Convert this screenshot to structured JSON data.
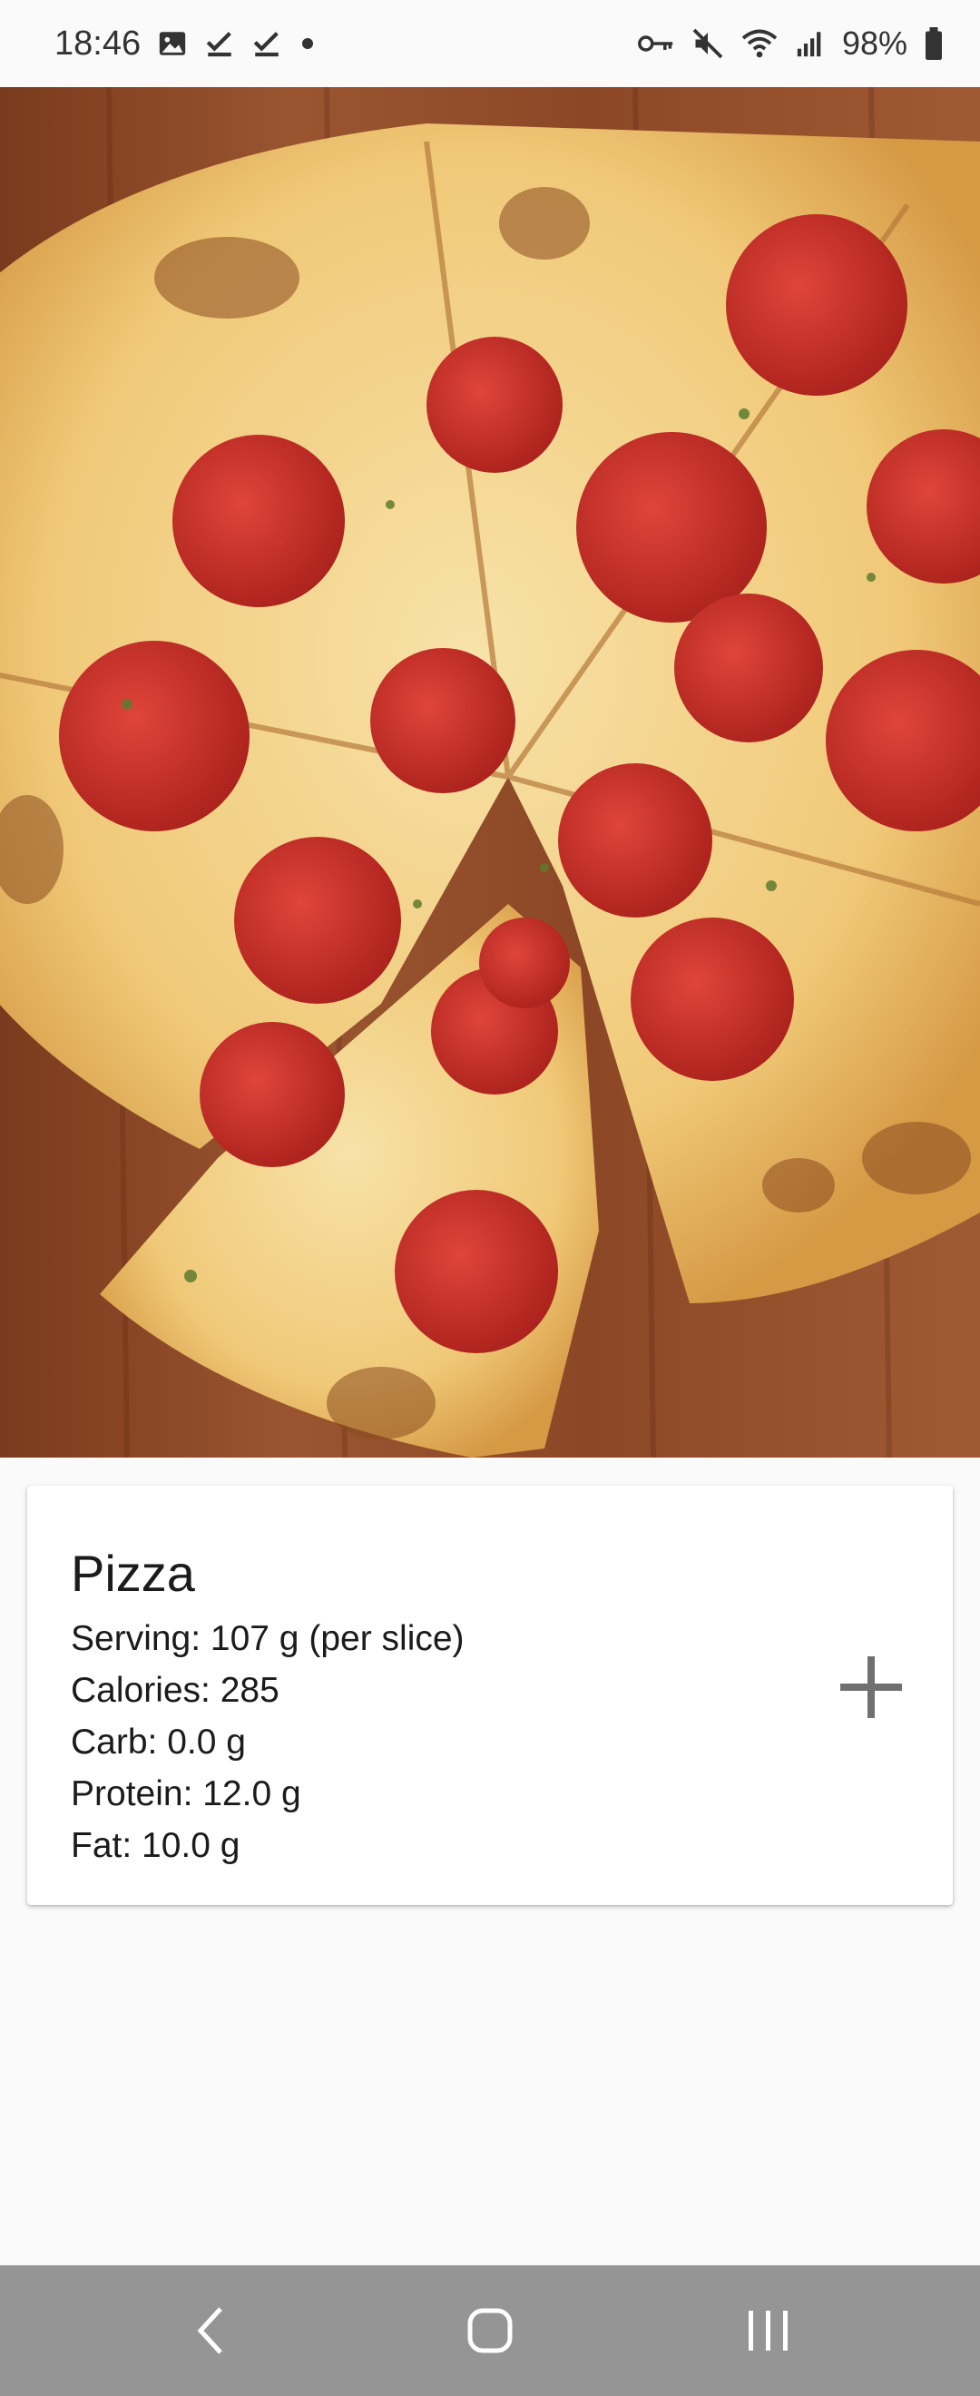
{
  "status_bar": {
    "time": "18:46",
    "battery": "98%",
    "left_icons": [
      "gallery-icon",
      "check-icon",
      "check-icon",
      "dot-icon"
    ],
    "right_icons": [
      "key-icon",
      "mute-icon",
      "wifi-icon",
      "signal-icon",
      "battery-icon"
    ]
  },
  "hero_image": {
    "subject": "pepperoni pizza"
  },
  "food": {
    "name": "Pizza",
    "serving": "Serving: 107 g (per slice)",
    "calories": "Calories: 285",
    "carb": "Carb: 0.0 g",
    "protein": "Protein: 12.0 g",
    "fat": "Fat: 10.0 g"
  },
  "actions": {
    "add_icon": "plus-icon"
  },
  "nav_bar": {
    "buttons": [
      "back-icon",
      "home-icon",
      "recents-icon"
    ]
  },
  "colors": {
    "background": "#fafafa",
    "card": "#ffffff",
    "nav_bar": "#959595",
    "icon_gray": "#707070"
  }
}
